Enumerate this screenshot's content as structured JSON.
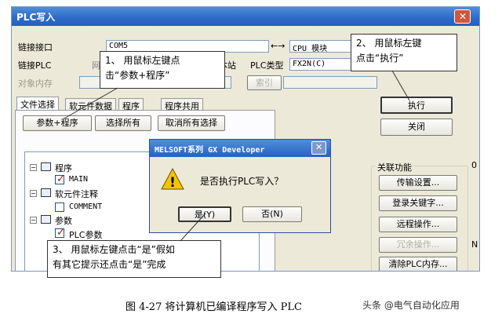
{
  "window": {
    "title": "PLC写入",
    "close_glyph": "✕",
    "link_port_label": "链接接口",
    "link_port_value": "COM5",
    "arrow_glyph": "←→",
    "cpu_module_value": "CPU 模块",
    "link_plc_label": "链接PLC",
    "link_plc_partial": "网",
    "station_label": "本站",
    "plc_type_label": "PLC类型",
    "plc_type_value": "FX2N(C)",
    "target_memory_label": "对象内存",
    "index_button": "索引",
    "tabs": [
      "文件选择",
      "软元件数据",
      "程序",
      "程序共用"
    ],
    "param_program_button": "参数+程序",
    "select_all_button": "选择所有",
    "deselect_all_button": "取消所有选择",
    "execute_button": "执行",
    "close_button": "关闭",
    "tree": {
      "program": "程序",
      "main": "MAIN",
      "device_comment": "软元件注释",
      "comment": "COMMENT",
      "parameter": "参数",
      "plc_param": "PLC参数"
    },
    "related_functions": {
      "title": "关联功能",
      "buttons": [
        "传输设置...",
        "登录关键字...",
        "远程操作...",
        "冗余操作...",
        "清除PLC内存..."
      ]
    },
    "edge_digit": "0",
    "edge_letter": "N"
  },
  "dialog": {
    "title": "MELSOFT系列 GX Developer",
    "close_glyph": "✕",
    "warning_glyph": "!",
    "message": "是否执行PLC写入？",
    "yes_button": "是(Y)",
    "no_button": "否(N)"
  },
  "callouts": {
    "c1_line1": "1、  用鼠标左键点",
    "c1_line2": "击“参数+程序”",
    "c2_line1": "2、  用鼠标左键",
    "c2_line2": "点击“执行”",
    "c3_line1": "3、  用鼠标左键点击“是”假如",
    "c3_line2": "有其它提示还点击“是”完成"
  },
  "caption": "图 4-27   将计算机已编译程序写入 PLC",
  "watermark": "头条 @电气自动化应用",
  "colors": {
    "titlebar": "#2e6cc8",
    "close": "#d4553a",
    "check": "#d40000",
    "warning": "#f5c400"
  }
}
